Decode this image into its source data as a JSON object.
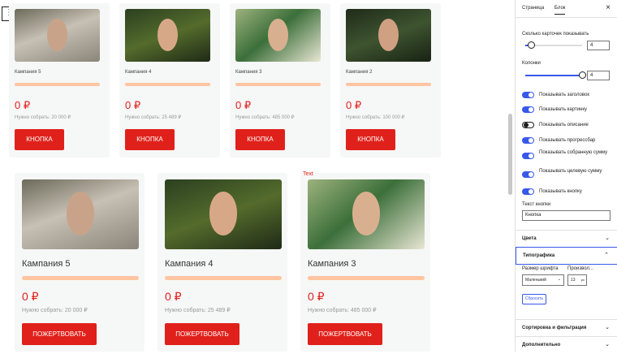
{
  "toolbar": {
    "menu_glyph": "⋮"
  },
  "small_cards": [
    {
      "title": "Кампания 5",
      "amount": "0 ₽",
      "goal": "Нужно собрать: 20 000 ₽",
      "button": "КНОПКА"
    },
    {
      "title": "Кампания 4",
      "amount": "0 ₽",
      "goal": "Нужно собрать: 25 489 ₽",
      "button": "КНОПКА"
    },
    {
      "title": "Кампания 3",
      "amount": "0 ₽",
      "goal": "Нужно собрать: 485 000 ₽",
      "button": "КНОПКА"
    },
    {
      "title": "Кампания 2",
      "amount": "0 ₽",
      "goal": "Нужно собрать: 100 000 ₽",
      "button": "КНОПКА"
    }
  ],
  "large_cards": [
    {
      "title": "Кампания 5",
      "amount": "0 ₽",
      "goal": "Нужно собрать: 20 000 ₽",
      "button": "ПОЖЕРТВОВАТЬ"
    },
    {
      "title": "Кампания 4",
      "amount": "0 ₽",
      "goal": "Нужно собрать: 25 489 ₽",
      "button": "ПОЖЕРТВОВАТЬ"
    },
    {
      "title": "Кампания 3",
      "amount": "0 ₽",
      "goal": "Нужно собрать: 485 000 ₽",
      "button": "ПОЖЕРТВОВАТЬ"
    }
  ],
  "text_tag": "Text",
  "sidebar": {
    "tab_page": "Страница",
    "tab_block": "Блок",
    "close": "×",
    "cards_label": "Сколько карточек показывать",
    "cards_value": "4",
    "cards_fraction": 0.1,
    "columns_label": "Колонки",
    "columns_value": "4",
    "columns_fraction": 1.0,
    "toggles": [
      {
        "label": "Показывать заголовок",
        "on": true
      },
      {
        "label": "Показывать картинку",
        "on": true
      },
      {
        "label": "Показывать описание",
        "on": false
      },
      {
        "label": "Показывать прогрессбар",
        "on": true
      },
      {
        "label": "Показывать собранную сумму",
        "on": true
      },
      {
        "label": "Показывать целевую сумму",
        "on": true
      },
      {
        "label": "Показывать кнопку",
        "on": true
      }
    ],
    "button_text_label": "Текст кнопки",
    "button_text_value": "Кнопка",
    "colors_section": "Цвета",
    "typography_section": "Типографика",
    "font_size_label": "Размер шрифта",
    "custom_label": "Произвол...",
    "font_size_select": "Маленький",
    "font_size_value": "13",
    "font_unit": "px",
    "reset": "Сбросить",
    "sort_section": "Сортировка и фильтрация",
    "extra_section": "Дополнительно"
  },
  "colors": {
    "accent": "#e0211b",
    "progress": "#ffc4a0",
    "wp_blue": "#3858e9"
  }
}
